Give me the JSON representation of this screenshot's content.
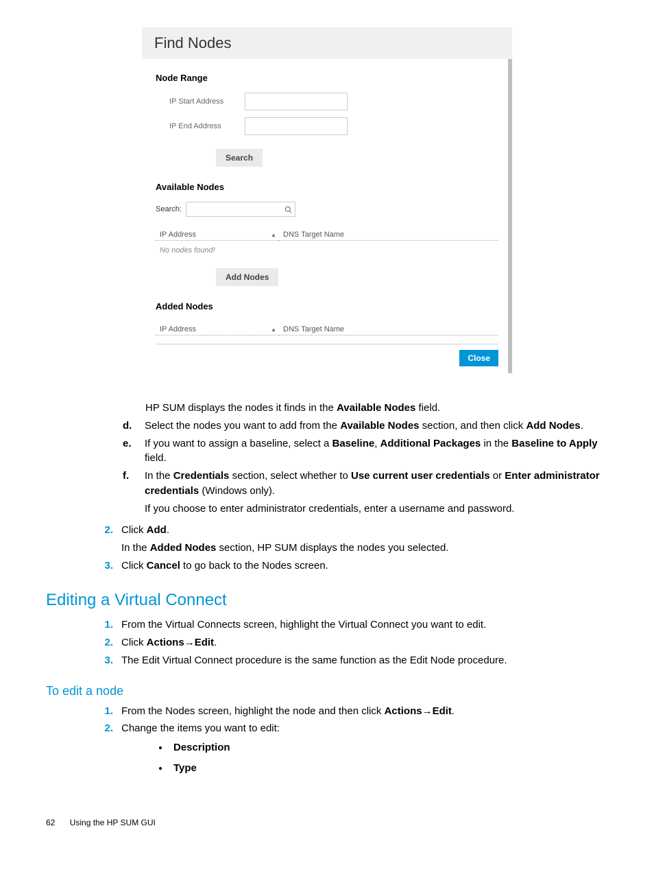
{
  "dialog": {
    "title": "Find Nodes",
    "node_range_label": "Node Range",
    "ip_start_label": "IP Start Address",
    "ip_end_label": "IP End Address",
    "search_btn": "Search",
    "available_label": "Available Nodes",
    "search_label": "Search:",
    "col_ip": "IP Address",
    "col_dns": "DNS Target Name",
    "no_nodes": "No nodes found!",
    "add_nodes_btn": "Add Nodes",
    "added_label": "Added Nodes",
    "close_btn": "Close"
  },
  "doc": {
    "p1_a": "HP SUM displays the nodes it finds in the ",
    "p1_b": "Available Nodes",
    "p1_c": " field.",
    "d_marker": "d.",
    "d_1": "Select the nodes you want to add from the ",
    "d_2": "Available Nodes",
    "d_3": " section, and then click ",
    "d_4": "Add Nodes",
    "d_5": ".",
    "e_marker": "e.",
    "e_1": "If you want to assign a baseline, select a ",
    "e_2": "Baseline",
    "e_3": ", ",
    "e_4": "Additional Packages",
    "e_5": " in the ",
    "e_6": "Baseline to Apply",
    "e_7": " field.",
    "f_marker": "f.",
    "f_1": "In the ",
    "f_2": "Credentials",
    "f_3": " section, select whether to ",
    "f_4": "Use current user credentials",
    "f_5": " or ",
    "f_6": "Enter administrator credentials",
    "f_7": " (Windows only).",
    "f_sub": "If you choose to enter administrator credentials, enter a username and password.",
    "n2_marker": "2.",
    "n2_1": "Click ",
    "n2_2": "Add",
    "n2_3": ".",
    "n2_sub_1": "In the ",
    "n2_sub_2": "Added Nodes",
    "n2_sub_3": " section, HP SUM displays the nodes you selected.",
    "n3_marker": "3.",
    "n3_1": "Click ",
    "n3_2": "Cancel",
    "n3_3": " to go back to the Nodes screen.",
    "h2_vc": "Editing a Virtual Connect",
    "vc1_marker": "1.",
    "vc1": "From the Virtual Connects screen, highlight the Virtual Connect you want to edit.",
    "vc2_marker": "2.",
    "vc2_1": "Click ",
    "vc2_2": "Actions",
    "vc2_arrow": "→",
    "vc2_3": "Edit",
    "vc2_4": ".",
    "vc3_marker": "3.",
    "vc3": "The Edit Virtual Connect procedure is the same function as the Edit Node procedure.",
    "h3_edit": "To edit a node",
    "en1_marker": "1.",
    "en1_1": "From the Nodes screen, highlight the node and then click ",
    "en1_2": "Actions",
    "en1_arrow": "→",
    "en1_3": "Edit",
    "en1_4": ".",
    "en2_marker": "2.",
    "en2": "Change the items you want to edit:",
    "bul1": "Description",
    "bul2": "Type",
    "footer_num": "62",
    "footer_txt": "Using the HP SUM GUI"
  }
}
